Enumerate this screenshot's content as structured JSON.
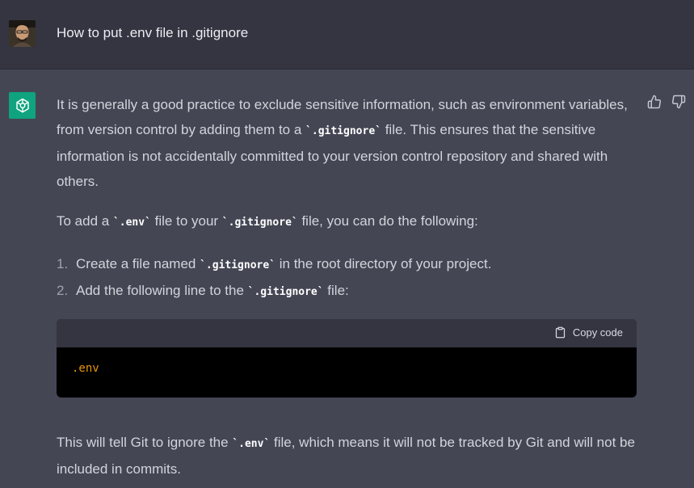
{
  "user_message": {
    "text": "How to put .env file in .gitignore"
  },
  "assistant_message": {
    "p1_a": "It is generally a good practice to exclude sensitive information, such as environment variables, from version control by adding them to a ",
    "p1_code": "`.gitignore`",
    "p1_b": " file. This ensures that the sensitive information is not accidentally committed to your version control repository and shared with others.",
    "p2_a": "To add a ",
    "p2_code1": "`.env`",
    "p2_b": " file to your ",
    "p2_code2": "`.gitignore`",
    "p2_c": " file, you can do the following:",
    "list": [
      {
        "num": "1.",
        "a": "Create a file named ",
        "code": "`.gitignore`",
        "b": " in the root directory of your project."
      },
      {
        "num": "2.",
        "a": "Add the following line to the ",
        "code": "`.gitignore`",
        "b": " file:"
      }
    ],
    "code_block": {
      "copy_label": "Copy code",
      "code": ".env",
      "code_color": "#e9950c"
    },
    "p3_a": "This will tell Git to ignore the ",
    "p3_code": "`.env`",
    "p3_b": " file, which means it will not be tracked by Git and will not be included in commits."
  },
  "colors": {
    "user_bg": "#343541",
    "assistant_bg": "#444654",
    "logo_bg": "#10a37f"
  },
  "icons": [
    "user-avatar",
    "chatgpt-logo-icon",
    "thumbs-up-icon",
    "thumbs-down-icon",
    "clipboard-icon"
  ]
}
